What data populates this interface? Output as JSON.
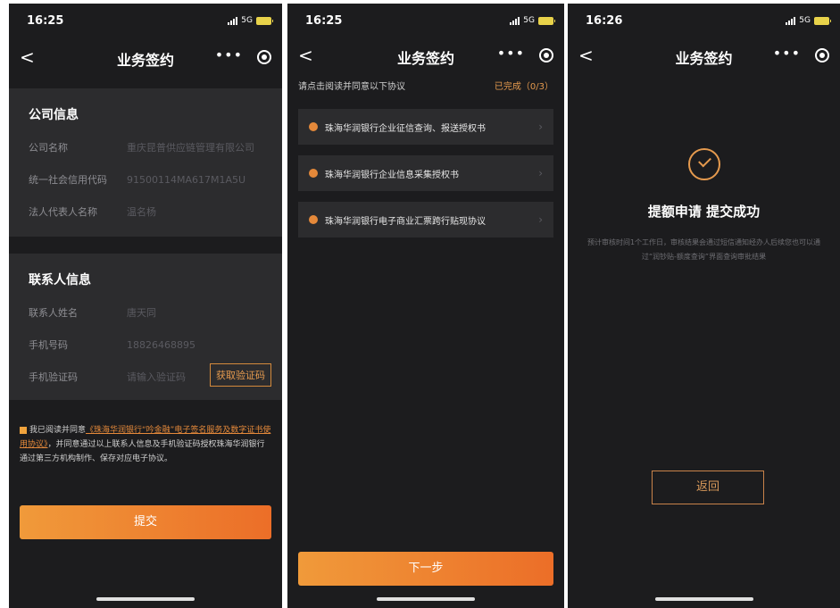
{
  "status": {
    "left": {
      "time": "16:25",
      "network": "5G"
    },
    "middle": {
      "time": "16:25",
      "network": "5G"
    },
    "right": {
      "time": "16:26",
      "network": "5G"
    }
  },
  "nav": {
    "title": "业务签约",
    "back": "<",
    "more": "•••"
  },
  "screen1": {
    "company_section": {
      "title": "公司信息",
      "rows": [
        {
          "label": "公司名称",
          "value": "重庆昆普供应链管理有限公司"
        },
        {
          "label": "统一社会信用代码",
          "value": "91500114MA617M1A5U"
        },
        {
          "label": "法人代表人名称",
          "value": "温名杨"
        }
      ]
    },
    "contact_section": {
      "title": "联系人信息",
      "rows": [
        {
          "label": "联系人姓名",
          "value": "唐天同"
        },
        {
          "label": "手机号码",
          "value": "18826468895"
        },
        {
          "label": "手机验证码",
          "value": "请输入验证码"
        }
      ],
      "get_code_label": "获取验证码"
    },
    "agreement": {
      "prefix": "我已阅读并同意",
      "link": "《珠海华润银行“吟金融”电子签名服务及数字证书使用协议》",
      "suffix": "，并同意通过以上联系人信息及手机验证码授权珠海华润银行通过第三方机构制作、保存对应电子协议。"
    },
    "submit_label": "提交"
  },
  "screen2": {
    "tip": "请点击阅读并同意以下协议",
    "progress": "已完成（0/3）",
    "agreements": [
      "珠海华润银行企业征信查询、报送授权书",
      "珠海华润银行企业信息采集授权书",
      "珠海华润银行电子商业汇票跨行贴现协议"
    ],
    "next_label": "下一步"
  },
  "screen3": {
    "success_title": "提额申请 提交成功",
    "success_desc": "预计审核时间1个工作日，审核结果会通过短信通知经办人后续您也可以通过“润钞贴-额度查询”界面查询审批结果",
    "back_label": "返回"
  },
  "colors": {
    "background": "#1c1c1e",
    "card": "#2c2c2e",
    "accent": "#ec6e28",
    "accent_light": "#f09a3a"
  },
  "icons": [
    "back-icon",
    "more-icon",
    "target-icon",
    "warning-dot-icon",
    "chevron-right-icon",
    "success-check-icon",
    "checkbox-icon"
  ]
}
